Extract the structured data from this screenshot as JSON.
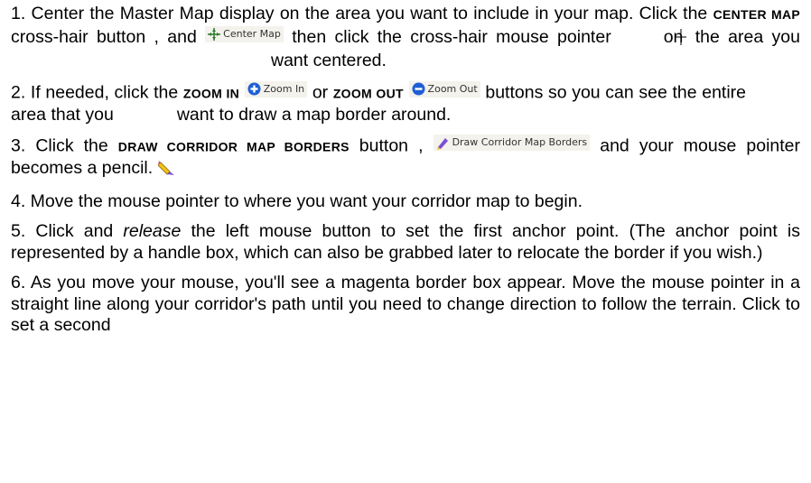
{
  "steps": [
    {
      "a": "1. Center the Master Map display on the area you want to include in your map. Click the ",
      "kw": "Center Map",
      "b": " cross-hair button , and ",
      "btn": "Center Map",
      "c": " then  click the cross-hair mouse pointer",
      "d": "on",
      "e": " the area you",
      "f": "want",
      "g": "centered."
    },
    {
      "a": "2. If needed, click the ",
      "kw1": "Zoom In",
      "btn1": "Zoom In",
      "or": " or ",
      "kw2": "Zoom Out",
      "btn2": "Zoom Out",
      "b": " buttons so you can see the entire",
      "c": "area that you",
      "d": "want to draw a map border around."
    },
    {
      "a": "3. Click the ",
      "kw": "Draw Corridor Map Borders",
      "b": " button , ",
      "btn": "Draw Corridor Map Borders",
      "c": " and your mouse pointer becomes a pencil. "
    },
    {
      "text": "4. Move the mouse pointer to where you want your corridor map to begin."
    },
    {
      "a": "5. Click and ",
      "em": "release",
      "b": " the left mouse button to set the first anchor point. (The anchor point is represented by a handle box, which can also be grabbed later to relocate the border if you wish.)"
    },
    {
      "text": "6. As you move your mouse, you'll see a magenta border box appear. Move the mouse pointer in a straight line along your corridor's path until you need to change direction to follow the terrain. Click to set a second"
    }
  ],
  "icons": {
    "center": "crosshair-icon",
    "zoom_in": "plus-circle-icon",
    "zoom_out": "minus-circle-icon",
    "corridor": "corridor-pencil-icon",
    "pencil": "pencil-icon"
  },
  "colors": {
    "zoom": "#1f5fd6",
    "corridor": "#7a4fd0",
    "pencil": "#f2c21b"
  }
}
